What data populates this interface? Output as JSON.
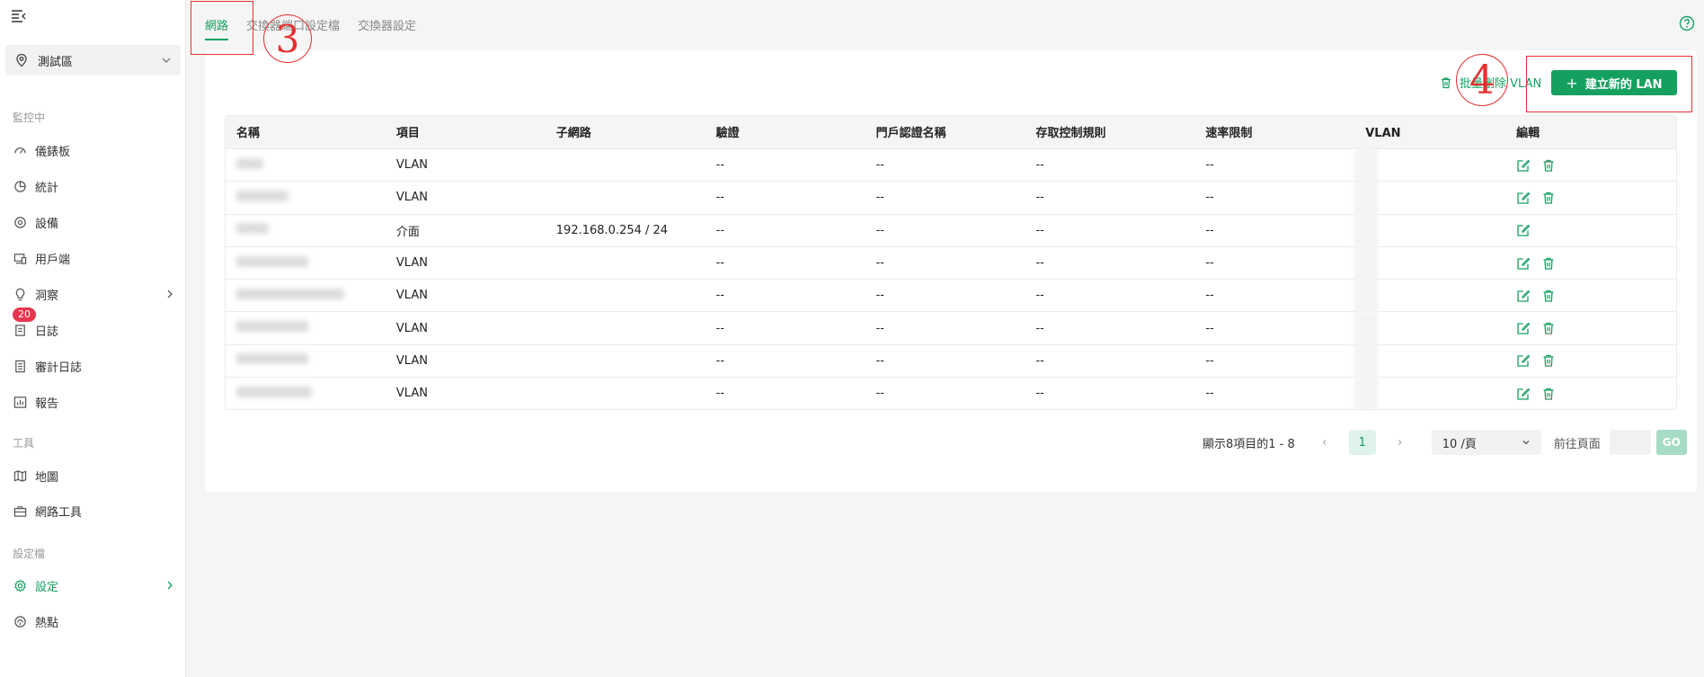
{
  "sidebar": {
    "site_name": "測試區",
    "sections": {
      "monitoring": "監控中",
      "tools": "工具",
      "settings": "設定檔"
    },
    "items": [
      {
        "key": "dashboard",
        "label": "儀錶板",
        "icon": "gauge-icon"
      },
      {
        "key": "stats",
        "label": "統計",
        "icon": "pie-chart-icon"
      },
      {
        "key": "devices",
        "label": "設備",
        "icon": "device-icon"
      },
      {
        "key": "clients",
        "label": "用戶端",
        "icon": "clients-icon"
      },
      {
        "key": "insights",
        "label": "洞察",
        "icon": "lightbulb-icon"
      },
      {
        "key": "logs",
        "label": "日誌",
        "icon": "log-icon",
        "badge": "20"
      },
      {
        "key": "audit",
        "label": "審計日誌",
        "icon": "audit-icon"
      },
      {
        "key": "reports",
        "label": "報告",
        "icon": "report-icon"
      },
      {
        "key": "map",
        "label": "地圖",
        "icon": "map-icon"
      },
      {
        "key": "nettools",
        "label": "網路工具",
        "icon": "toolbox-icon"
      },
      {
        "key": "settings",
        "label": "設定",
        "icon": "gear-icon"
      },
      {
        "key": "hotspot",
        "label": "熱點",
        "icon": "hotspot-icon"
      }
    ]
  },
  "tabs": [
    {
      "label": "網路",
      "active": true
    },
    {
      "label": "交換器端口設定檔",
      "active": false
    },
    {
      "label": "交換器設定",
      "active": false
    }
  ],
  "annotations": {
    "three": "3",
    "four": "4"
  },
  "toolbar": {
    "batch_delete": "批量刪除 VLAN",
    "create": "建立新的 LAN"
  },
  "table": {
    "headers": [
      "名稱",
      "項目",
      "子網路",
      "驗證",
      "門戶認證名稱",
      "存取控制規則",
      "速率限制",
      "VLAN",
      "編輯"
    ],
    "rows": [
      {
        "type": "VLAN",
        "subnet": "",
        "auth": "--",
        "portal": "--",
        "acl": "--",
        "rate": "--",
        "deletable": true
      },
      {
        "type": "VLAN",
        "subnet": "",
        "auth": "--",
        "portal": "--",
        "acl": "--",
        "rate": "--",
        "deletable": true
      },
      {
        "type": "介面",
        "subnet": "192.168.0.254 / 24",
        "auth": "--",
        "portal": "--",
        "acl": "--",
        "rate": "--",
        "deletable": false
      },
      {
        "type": "VLAN",
        "subnet": "",
        "auth": "--",
        "portal": "--",
        "acl": "--",
        "rate": "--",
        "deletable": true
      },
      {
        "type": "VLAN",
        "subnet": "",
        "auth": "--",
        "portal": "--",
        "acl": "--",
        "rate": "--",
        "deletable": true
      },
      {
        "type": "VLAN",
        "subnet": "",
        "auth": "--",
        "portal": "--",
        "acl": "--",
        "rate": "--",
        "deletable": true
      },
      {
        "type": "VLAN",
        "subnet": "",
        "auth": "--",
        "portal": "--",
        "acl": "--",
        "rate": "--",
        "deletable": true
      },
      {
        "type": "VLAN",
        "subnet": "",
        "auth": "--",
        "portal": "--",
        "acl": "--",
        "rate": "--",
        "deletable": true
      }
    ]
  },
  "pagination": {
    "info": "顯示8項目的1 - 8",
    "current_page": "1",
    "page_size": "10 /頁",
    "goto_label": "前往頁面",
    "go": "GO"
  },
  "colors": {
    "accent": "#16a060",
    "annotation": "#e53030",
    "badge": "#e8364f"
  }
}
